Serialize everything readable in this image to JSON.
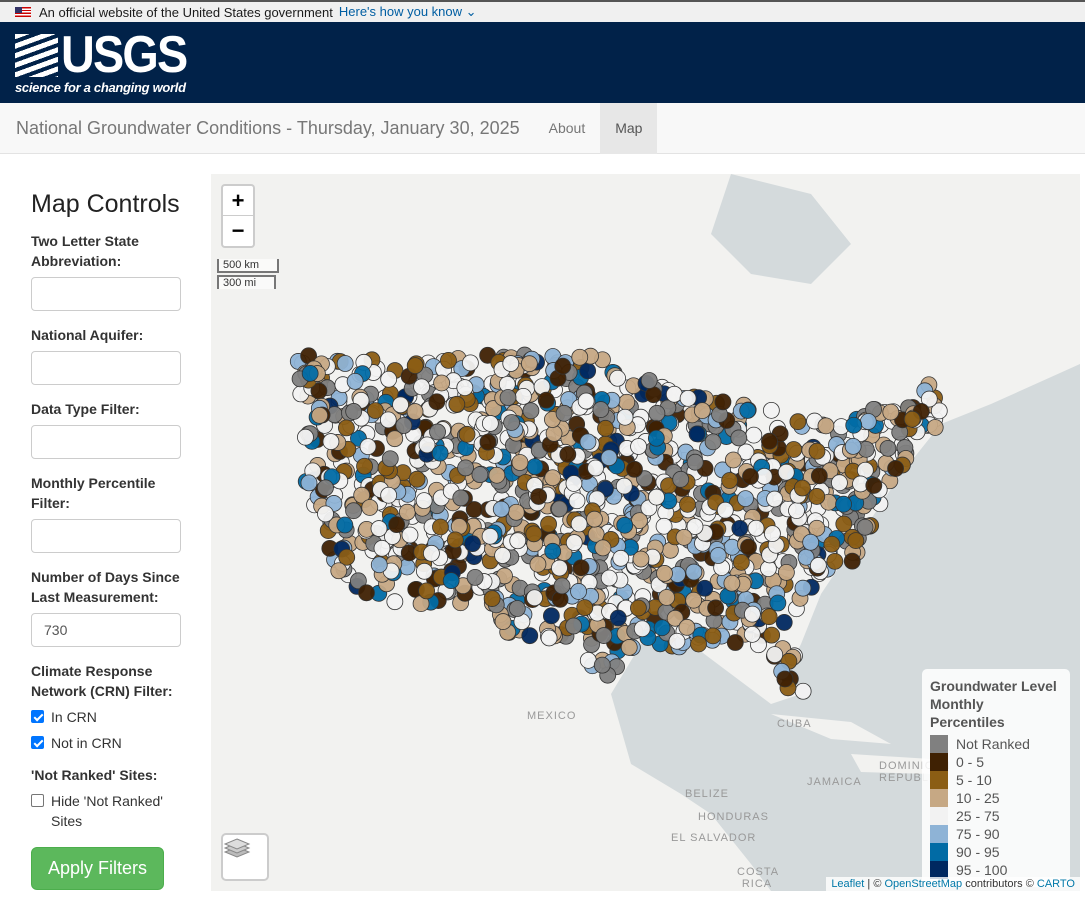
{
  "gov_banner": {
    "text": "An official website of the United States government",
    "link": "Here's how you know"
  },
  "header": {
    "logo_text": "USGS",
    "tagline": "science for a changing world"
  },
  "nav": {
    "title": "National Groundwater Conditions - Thursday, January 30, 2025",
    "links": [
      {
        "label": "About",
        "active": false
      },
      {
        "label": "Map",
        "active": true
      }
    ]
  },
  "controls": {
    "heading": "Map Controls",
    "state_label": "Two Letter State Abbreviation:",
    "state_value": "",
    "aquifer_label": "National Aquifer:",
    "aquifer_value": "",
    "datatype_label": "Data Type Filter:",
    "datatype_value": "",
    "percentile_label": "Monthly Percentile Filter:",
    "percentile_value": "",
    "days_label": "Number of Days Since Last Measurement:",
    "days_value": "730",
    "crn_label": "Climate Response Network (CRN) Filter:",
    "crn_options": [
      {
        "label": "In CRN",
        "checked": true
      },
      {
        "label": "Not in CRN",
        "checked": true
      }
    ],
    "notranked_label": "'Not Ranked' Sites:",
    "notranked_option": {
      "label": "Hide 'Not Ranked' Sites",
      "checked": false
    },
    "apply_label": "Apply Filters"
  },
  "map": {
    "zoom_in": "+",
    "zoom_out": "−",
    "scale_km": "500 km",
    "scale_mi": "300 mi",
    "labels": [
      "MEXICO",
      "CUBA",
      "JAMAICA",
      "BELIZE",
      "HONDURAS",
      "EL SALVADOR",
      "COSTA RICA",
      "DOMINICAN REPUBLIC"
    ],
    "legend": {
      "title": "Groundwater Level Monthly Percentiles",
      "items": [
        {
          "label": "Not Ranked",
          "color": "#808080"
        },
        {
          "label": "0 - 5",
          "color": "#3f2103"
        },
        {
          "label": "5 - 10",
          "color": "#8b5d14"
        },
        {
          "label": "10 - 25",
          "color": "#c6a884"
        },
        {
          "label": "25 - 75",
          "color": "#f2f2f2"
        },
        {
          "label": "75 - 90",
          "color": "#8eb3d6"
        },
        {
          "label": "90 - 95",
          "color": "#016ba5"
        },
        {
          "label": "95 - 100",
          "color": "#002860"
        }
      ]
    },
    "attribution": {
      "leaflet": "Leaflet",
      "sep": " | © ",
      "osm": "OpenStreetMap",
      "mid": " contributors © ",
      "carto": "CARTO"
    }
  }
}
